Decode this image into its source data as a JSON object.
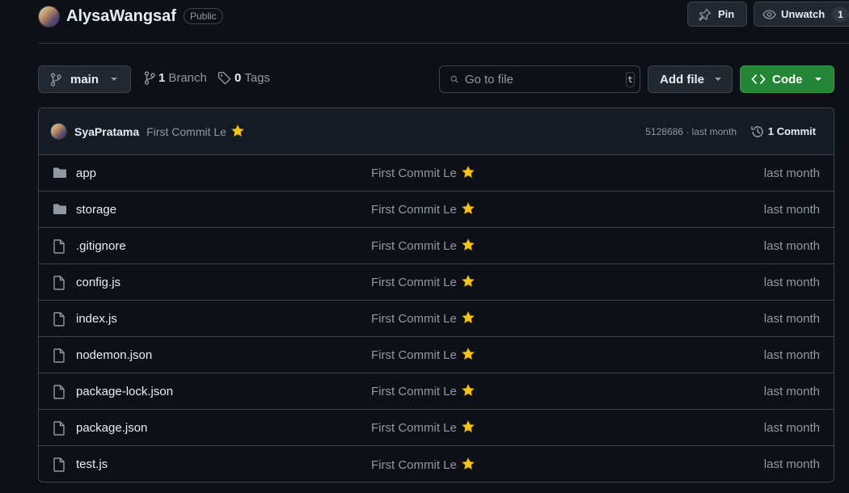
{
  "repo": {
    "name": "AlysaWangsaf",
    "visibility": "Public"
  },
  "header": {
    "pin_label": "Pin",
    "watch_label": "Unwatch",
    "watch_count": "1"
  },
  "toolbar": {
    "branch": "main",
    "branch_count": "1",
    "branch_label": "Branch",
    "tag_count": "0",
    "tag_label": "Tags",
    "search_placeholder": "Go to file",
    "search_shortcut": "t",
    "add_file_label": "Add file",
    "code_label": "Code"
  },
  "latest_commit": {
    "author": "SyaPratama",
    "message": "First Commit Le",
    "emoji": "star",
    "sha_time": "5128686 · last month",
    "commits_label": "1 Commit"
  },
  "files": [
    {
      "name": "app",
      "type": "folder",
      "message": "First Commit Le",
      "date": "last month"
    },
    {
      "name": "storage",
      "type": "folder",
      "message": "First Commit Le",
      "date": "last month"
    },
    {
      "name": ".gitignore",
      "type": "file",
      "message": "First Commit Le",
      "date": "last month"
    },
    {
      "name": "config.js",
      "type": "file",
      "message": "First Commit Le",
      "date": "last month"
    },
    {
      "name": "index.js",
      "type": "file",
      "message": "First Commit Le",
      "date": "last month"
    },
    {
      "name": "nodemon.json",
      "type": "file",
      "message": "First Commit Le",
      "date": "last month"
    },
    {
      "name": "package-lock.json",
      "type": "file",
      "message": "First Commit Le",
      "date": "last month"
    },
    {
      "name": "package.json",
      "type": "file",
      "message": "First Commit Le",
      "date": "last month"
    },
    {
      "name": "test.js",
      "type": "file",
      "message": "First Commit Le",
      "date": "last month"
    }
  ],
  "colors": {
    "background": "#0d1117",
    "border": "#3d444d",
    "accent_green": "#238636",
    "muted_text": "#9198a1",
    "star": "#f5c518"
  }
}
